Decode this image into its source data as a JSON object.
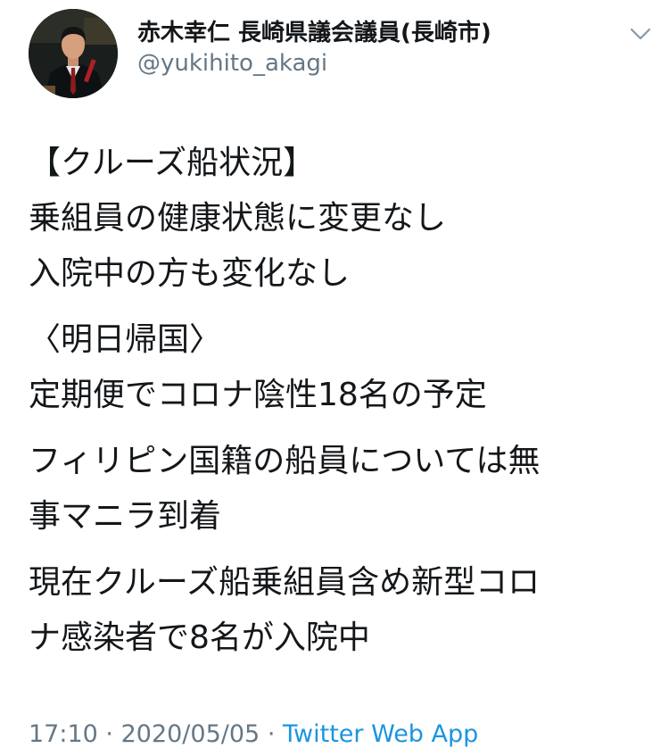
{
  "user": {
    "display_name": "赤木幸仁 長崎県議会議員(長崎市)",
    "handle": "@yukihito_akagi"
  },
  "tweet": {
    "paragraphs": [
      [
        "【クルーズ船状況】",
        "乗組員の健康状態に変更なし",
        "入院中の方も変化なし"
      ],
      [
        "〈明日帰国〉",
        "定期便でコロナ陰性18名の予定"
      ],
      [
        "フィリピン国籍の船員については無",
        "事マニラ到着"
      ],
      [
        "現在クルーズ船乗組員含め新型コロ",
        "ナ感染者で8名が入院中"
      ]
    ]
  },
  "meta": {
    "time": "17:10",
    "separator": "·",
    "date": "2020/05/05",
    "app": "Twitter Web App"
  },
  "icons": {
    "caret": "chevron-down-icon"
  },
  "colors": {
    "text": "#14171a",
    "secondary": "#657786",
    "link": "#1b95e0",
    "background": "#ffffff"
  }
}
